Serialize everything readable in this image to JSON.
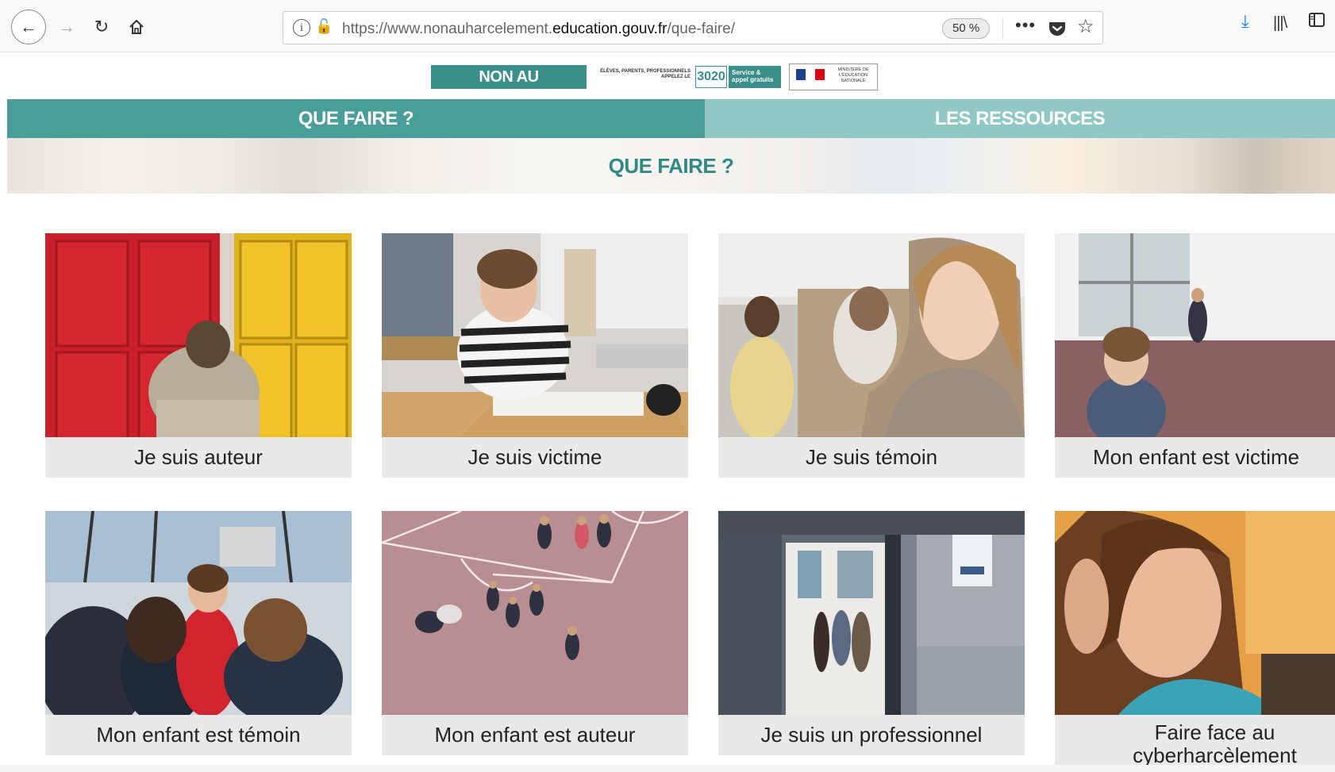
{
  "browser": {
    "url_prefix": "https://www.nonauharcelement.",
    "url_domain": "education.gouv.fr",
    "url_suffix": "/que-faire/",
    "zoom": "50 %",
    "more_label": "•••"
  },
  "header": {
    "logo_text": "NON AU HARCÈLEMENT",
    "logo_subtext": "ÉLÈVES, PARENTS, PROFESSIONNELS APPELEZ LE",
    "phone": "3020",
    "service_text": "Service & appel gratuits",
    "ministry_text": "MINISTÈRE DE L'ÉDUCATION NATIONALE"
  },
  "nav": {
    "tabs": [
      {
        "label": "QUE FAIRE ?",
        "active": true
      },
      {
        "label": "LES RESSOURCES",
        "active": false
      }
    ]
  },
  "banner": {
    "title": "QUE FAIRE ?"
  },
  "cards": [
    {
      "label": "Je suis auteur",
      "image": "child-crouching-by-lockers"
    },
    {
      "label": "Je suis victime",
      "image": "boy-in-classroom-head-in-hand"
    },
    {
      "label": "Je suis témoin",
      "image": "girl-looking-down"
    },
    {
      "label": "Mon enfant est victime",
      "image": "boy-alone-in-schoolyard"
    },
    {
      "label": "Mon enfant est témoin",
      "image": "group-of-children"
    },
    {
      "label": "Mon enfant est auteur",
      "image": "aerial-playground"
    },
    {
      "label": "Je suis un professionnel",
      "image": "teachers-room-doorway"
    },
    {
      "label": "Faire face au cyberharcèlement",
      "image": "girl-at-laptop"
    }
  ],
  "colors": {
    "teal": "#4a9e99",
    "teal_light": "#8fc8c4",
    "teal_text": "#2f8a85",
    "card_label_bg": "#e9e9e9"
  }
}
